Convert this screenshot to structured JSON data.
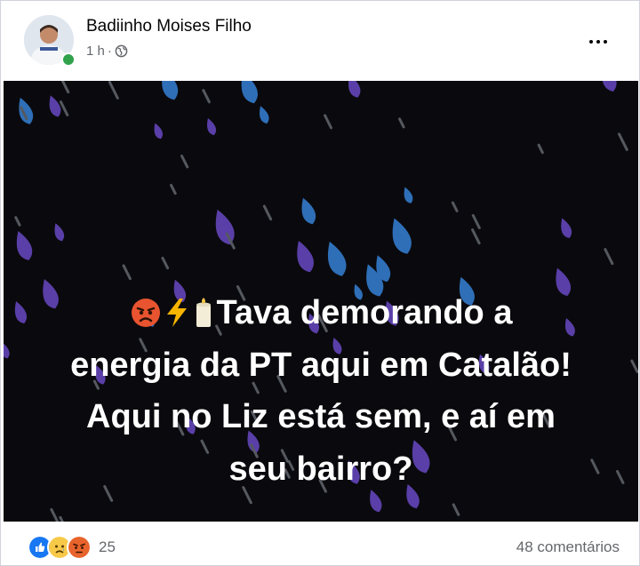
{
  "post": {
    "author": "Badiinho Moises Filho",
    "time": "1 h",
    "separator": "·",
    "audience_icon": "globe-icon",
    "more_icon": "more-options-icon",
    "text_lines": [
      "Tava demorando a",
      "energia da PT aqui em Catalão!",
      "Aqui no Liz está sem, e aí em",
      "seu bairro?"
    ],
    "text_emojis": [
      "angry-face",
      "lightning-bolt",
      "candle"
    ],
    "image_background": "dark with blue, purple and grey raindrops"
  },
  "footer": {
    "reactions": [
      "like",
      "sad",
      "angry"
    ],
    "reaction_count": "25",
    "comments": "48 comentários"
  },
  "colors": {
    "primary_text": "#050505",
    "secondary_text": "#65676b",
    "online": "#31a24c",
    "like_blue": "#1877f2",
    "image_bg": "#0a0a0e"
  }
}
